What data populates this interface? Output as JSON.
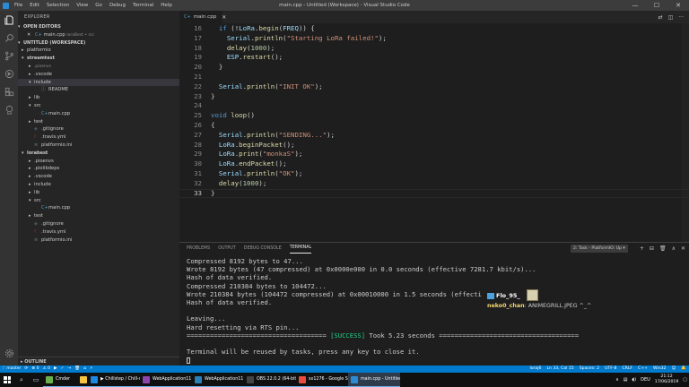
{
  "window": {
    "title": "main.cpp - Untitled (Workspace) - Visual Studio Code",
    "menu": [
      "File",
      "Edit",
      "Selection",
      "View",
      "Go",
      "Debug",
      "Terminal",
      "Help"
    ],
    "controls": {
      "minimize": "—",
      "maximize": "☐",
      "close": "✕"
    }
  },
  "sidebar": {
    "title": "EXPLORER",
    "open_editors_header": "OPEN EDITORS",
    "open_editor": {
      "close": "✕",
      "icon": "C+",
      "name": "main.cpp",
      "path": "loraBest • src"
    },
    "workspace_header": "UNTITLED (WORKSPACE)",
    "tree": [
      {
        "depth": 0,
        "arrow": "▸",
        "label": "platformio",
        "type": "folder"
      },
      {
        "depth": 0,
        "arrow": "▾",
        "label": "streamtest",
        "type": "section"
      },
      {
        "depth": 1,
        "arrow": "▸",
        "label": ".pioenvs",
        "type": "dim"
      },
      {
        "depth": 1,
        "arrow": "▸",
        "label": ".vscode",
        "type": "folder"
      },
      {
        "depth": 1,
        "arrow": "▾",
        "label": "include",
        "type": "folder",
        "active": true
      },
      {
        "depth": 2,
        "arrow": "",
        "icon": "ⓘ",
        "label": "README",
        "type": "file"
      },
      {
        "depth": 1,
        "arrow": "▸",
        "label": "lib",
        "type": "folder"
      },
      {
        "depth": 1,
        "arrow": "▾",
        "label": "src",
        "type": "folder"
      },
      {
        "depth": 2,
        "arrow": "",
        "icon": "C+",
        "label": "main.cpp",
        "type": "file"
      },
      {
        "depth": 1,
        "arrow": "▸",
        "label": "test",
        "type": "folder"
      },
      {
        "depth": 1,
        "arrow": "",
        "icon": "◆",
        "label": ".gitignore",
        "type": "file"
      },
      {
        "depth": 1,
        "arrow": "",
        "icon": "!",
        "label": ".travis.yml",
        "type": "file"
      },
      {
        "depth": 1,
        "arrow": "",
        "icon": "≡",
        "label": "platformio.ini",
        "type": "file"
      },
      {
        "depth": 0,
        "arrow": "▾",
        "label": "lorabest",
        "type": "section"
      },
      {
        "depth": 1,
        "arrow": "▸",
        "label": ".pioenvs",
        "type": "folder"
      },
      {
        "depth": 1,
        "arrow": "▸",
        "label": ".piolibdeps",
        "type": "folder"
      },
      {
        "depth": 1,
        "arrow": "▸",
        "label": ".vscode",
        "type": "folder"
      },
      {
        "depth": 1,
        "arrow": "▸",
        "label": "include",
        "type": "folder"
      },
      {
        "depth": 1,
        "arrow": "▸",
        "label": "lib",
        "type": "folder"
      },
      {
        "depth": 1,
        "arrow": "▾",
        "label": "src",
        "type": "folder"
      },
      {
        "depth": 2,
        "arrow": "",
        "icon": "C+",
        "label": "main.cpp",
        "type": "file"
      },
      {
        "depth": 1,
        "arrow": "▸",
        "label": "test",
        "type": "folder"
      },
      {
        "depth": 1,
        "arrow": "",
        "icon": "◆",
        "label": ".gitignore",
        "type": "file"
      },
      {
        "depth": 1,
        "arrow": "",
        "icon": "!",
        "label": ".travis.yml",
        "type": "file"
      },
      {
        "depth": 1,
        "arrow": "",
        "icon": "≡",
        "label": "platformio.ini",
        "type": "file"
      }
    ],
    "outline": "▸ OUTLINE"
  },
  "tabs": [
    {
      "icon": "C+",
      "label": "main.cpp",
      "close": "✕"
    }
  ],
  "editor": {
    "current_line": 33,
    "lines": [
      {
        "n": "16",
        "t": [
          [
            "  ",
            "pl"
          ],
          [
            "if",
            "kw"
          ],
          [
            " (!",
            "pl"
          ],
          [
            "LoRa",
            "var"
          ],
          [
            ".",
            "pl"
          ],
          [
            "begin",
            "fn"
          ],
          [
            "(",
            "pl"
          ],
          [
            "FREQ",
            "var"
          ],
          [
            ")) {",
            "pl"
          ]
        ]
      },
      {
        "n": "17",
        "t": [
          [
            "    ",
            "pl"
          ],
          [
            "Serial",
            "var"
          ],
          [
            ".",
            "pl"
          ],
          [
            "println",
            "fn"
          ],
          [
            "(",
            "pl"
          ],
          [
            "\"Starting LoRa failed!\"",
            "str"
          ],
          [
            ");",
            "pl"
          ]
        ]
      },
      {
        "n": "18",
        "t": [
          [
            "    ",
            "pl"
          ],
          [
            "delay",
            "fn"
          ],
          [
            "(",
            "pl"
          ],
          [
            "1000",
            "num"
          ],
          [
            ");",
            "pl"
          ]
        ]
      },
      {
        "n": "19",
        "t": [
          [
            "    ",
            "pl"
          ],
          [
            "ESP",
            "var"
          ],
          [
            ".",
            "pl"
          ],
          [
            "restart",
            "fn"
          ],
          [
            "();",
            "pl"
          ]
        ]
      },
      {
        "n": "20",
        "t": [
          [
            "  }",
            "pl"
          ]
        ]
      },
      {
        "n": "21",
        "t": []
      },
      {
        "n": "22",
        "t": [
          [
            "  ",
            "pl"
          ],
          [
            "Serial",
            "var"
          ],
          [
            ".",
            "pl"
          ],
          [
            "println",
            "fn"
          ],
          [
            "(",
            "pl"
          ],
          [
            "\"INIT OK\"",
            "str"
          ],
          [
            ");",
            "pl"
          ]
        ]
      },
      {
        "n": "23",
        "t": [
          [
            "}",
            "pl"
          ]
        ]
      },
      {
        "n": "24",
        "t": []
      },
      {
        "n": "25",
        "t": [
          [
            "void",
            "kw"
          ],
          [
            " ",
            "pl"
          ],
          [
            "loop",
            "fn"
          ],
          [
            "()",
            "pl"
          ]
        ]
      },
      {
        "n": "26",
        "t": [
          [
            "{",
            "pl"
          ]
        ]
      },
      {
        "n": "27",
        "t": [
          [
            "  ",
            "pl"
          ],
          [
            "Serial",
            "var"
          ],
          [
            ".",
            "pl"
          ],
          [
            "println",
            "fn"
          ],
          [
            "(",
            "pl"
          ],
          [
            "\"SENDING...\"",
            "str"
          ],
          [
            ");",
            "pl"
          ]
        ]
      },
      {
        "n": "28",
        "t": [
          [
            "  ",
            "pl"
          ],
          [
            "LoRa",
            "var"
          ],
          [
            ".",
            "pl"
          ],
          [
            "beginPacket",
            "fn"
          ],
          [
            "();",
            "pl"
          ]
        ]
      },
      {
        "n": "29",
        "t": [
          [
            "  ",
            "pl"
          ],
          [
            "LoRa",
            "var"
          ],
          [
            ".",
            "pl"
          ],
          [
            "print",
            "fn"
          ],
          [
            "(",
            "pl"
          ],
          [
            "\"monkaS\"",
            "str"
          ],
          [
            ");",
            "pl"
          ]
        ]
      },
      {
        "n": "30",
        "t": [
          [
            "  ",
            "pl"
          ],
          [
            "LoRa",
            "var"
          ],
          [
            ".",
            "pl"
          ],
          [
            "endPacket",
            "fn"
          ],
          [
            "();",
            "pl"
          ]
        ]
      },
      {
        "n": "31",
        "t": [
          [
            "  ",
            "pl"
          ],
          [
            "Serial",
            "var"
          ],
          [
            ".",
            "pl"
          ],
          [
            "println",
            "fn"
          ],
          [
            "(",
            "pl"
          ],
          [
            "\"OK\"",
            "str"
          ],
          [
            ");",
            "pl"
          ]
        ]
      },
      {
        "n": "32",
        "t": [
          [
            "  ",
            "pl"
          ],
          [
            "delay",
            "fn"
          ],
          [
            "(",
            "pl"
          ],
          [
            "1000",
            "num"
          ],
          [
            ");",
            "pl"
          ]
        ]
      },
      {
        "n": "33",
        "t": [
          [
            "}",
            "pl"
          ]
        ]
      }
    ]
  },
  "panel": {
    "tabs": [
      "PROBLEMS",
      "OUTPUT",
      "DEBUG CONSOLE",
      "TERMINAL"
    ],
    "active_tab": "TERMINAL",
    "task_select": "2: Task - PlatformIO: Up ▾",
    "icons": [
      "+",
      "⊟",
      "🗑",
      "∧",
      "✕"
    ],
    "terminal_lines": [
      "Compressed 8192 bytes to 47...",
      "Wrote 8192 bytes (47 compressed) at 0x0000e000 in 0.0 seconds (effective 7281.7 kbit/s)...",
      "Hash of data verified.",
      "Compressed 210384 bytes to 104472...",
      "Wrote 210384 bytes (104472 compressed) at 0x00010000 in 1.5 seconds (effecti",
      "Hash of data verified.",
      "",
      "Leaving...",
      "Hard resetting via RTS pin...",
      "==================================== [SUCCESS] Took 5.23 seconds ====================================",
      "",
      "Terminal will be reused by tasks, press any key to close it."
    ],
    "success_text": "[SUCCESS]"
  },
  "chat": {
    "name": "Flo_95_",
    "user": "neko0_chan",
    "message": ": ANIMEGRILL.JPEG ^_^"
  },
  "statusbar": {
    "left": [
      "ᚴ master",
      "⟳",
      "⊗ 0",
      "⚠ 0",
      "▶",
      "✓",
      "→",
      "🗑",
      "⌂",
      "⚡"
    ],
    "right": [
      "loraj6",
      "Ln 33, Col 15",
      "Spaces: 2",
      "UTF-8",
      "CRLF",
      "C++",
      "Win32",
      "☺",
      "🔔"
    ]
  },
  "taskbar": {
    "apps": [
      {
        "label": "Cmder",
        "color": "#6ab04c",
        "active": false
      },
      {
        "label": "",
        "color": "#f5c542",
        "active": false
      },
      {
        "label": "▶ Chillstep / Chill-st...",
        "color": "#1e88e5",
        "active": false
      },
      {
        "label": "WebApplication11 ...",
        "color": "#8e44ad",
        "active": false
      },
      {
        "label": "WebApplication11",
        "color": "#2980b9",
        "active": false
      },
      {
        "label": "OBS 22.0.2 (64-bit, ...",
        "color": "#444444",
        "active": false
      },
      {
        "label": "sx1276 - Google Su...",
        "color": "#e74c3c",
        "active": false
      },
      {
        "label": "main.cpp - Untitled...",
        "color": "#2a8ad4",
        "active": true
      }
    ],
    "tray": {
      "lang": "DEU",
      "time": "21:12",
      "date": "17/06/2019"
    }
  },
  "colors": {
    "accent": "#007acc",
    "editor_bg": "#1e1e1e",
    "sidebar_bg": "#252526",
    "success": "#23d18b"
  }
}
